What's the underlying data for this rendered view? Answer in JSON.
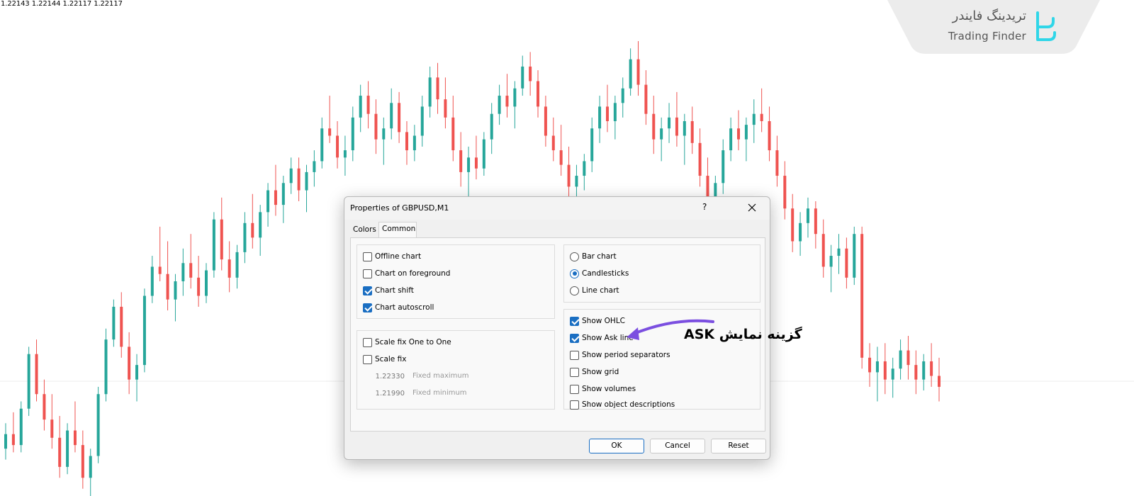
{
  "ohlc_readout": "1.22143 1.22144 1.22117 1.22117",
  "logo": {
    "persian_name": "تریدینگ فایندر",
    "english_name": "Trading Finder",
    "color": "#30d6e8"
  },
  "chart_data": {
    "type": "candlestick",
    "symbol": "GBPUSD",
    "timeframe": "M1",
    "bull_color": "#26a69a",
    "bear_color": "#ef5350",
    "grid": false,
    "candles": [
      {
        "o": 1.2171,
        "h": 1.2178,
        "l": 1.2168,
        "c": 1.2175
      },
      {
        "o": 1.2175,
        "h": 1.2181,
        "l": 1.217,
        "c": 1.2172
      },
      {
        "o": 1.2172,
        "h": 1.2184,
        "l": 1.217,
        "c": 1.2182
      },
      {
        "o": 1.2182,
        "h": 1.2199,
        "l": 1.218,
        "c": 1.2197
      },
      {
        "o": 1.2197,
        "h": 1.2201,
        "l": 1.2184,
        "c": 1.2186
      },
      {
        "o": 1.2186,
        "h": 1.219,
        "l": 1.2176,
        "c": 1.2179
      },
      {
        "o": 1.2179,
        "h": 1.2186,
        "l": 1.2171,
        "c": 1.2174
      },
      {
        "o": 1.2174,
        "h": 1.218,
        "l": 1.2163,
        "c": 1.2166
      },
      {
        "o": 1.2166,
        "h": 1.2178,
        "l": 1.2164,
        "c": 1.2176
      },
      {
        "o": 1.2176,
        "h": 1.2184,
        "l": 1.217,
        "c": 1.2172
      },
      {
        "o": 1.2172,
        "h": 1.2176,
        "l": 1.216,
        "c": 1.2163
      },
      {
        "o": 1.2163,
        "h": 1.2171,
        "l": 1.2158,
        "c": 1.2169
      },
      {
        "o": 1.2169,
        "h": 1.2188,
        "l": 1.2167,
        "c": 1.2186
      },
      {
        "o": 1.2186,
        "h": 1.2204,
        "l": 1.2184,
        "c": 1.2201
      },
      {
        "o": 1.2201,
        "h": 1.2212,
        "l": 1.2199,
        "c": 1.221
      },
      {
        "o": 1.221,
        "h": 1.2214,
        "l": 1.2196,
        "c": 1.2199
      },
      {
        "o": 1.2199,
        "h": 1.2203,
        "l": 1.2186,
        "c": 1.219
      },
      {
        "o": 1.219,
        "h": 1.2197,
        "l": 1.2184,
        "c": 1.2194
      },
      {
        "o": 1.2194,
        "h": 1.2215,
        "l": 1.2192,
        "c": 1.2213
      },
      {
        "o": 1.2213,
        "h": 1.2224,
        "l": 1.2211,
        "c": 1.2221
      },
      {
        "o": 1.2221,
        "h": 1.2232,
        "l": 1.2217,
        "c": 1.2219
      },
      {
        "o": 1.2219,
        "h": 1.2228,
        "l": 1.2209,
        "c": 1.2212
      },
      {
        "o": 1.2212,
        "h": 1.2219,
        "l": 1.2206,
        "c": 1.2217
      },
      {
        "o": 1.2217,
        "h": 1.2226,
        "l": 1.2213,
        "c": 1.2222
      },
      {
        "o": 1.2222,
        "h": 1.223,
        "l": 1.2215,
        "c": 1.2218
      },
      {
        "o": 1.2218,
        "h": 1.2224,
        "l": 1.221,
        "c": 1.2213
      },
      {
        "o": 1.2213,
        "h": 1.2222,
        "l": 1.2211,
        "c": 1.222
      },
      {
        "o": 1.222,
        "h": 1.2236,
        "l": 1.2218,
        "c": 1.2234
      },
      {
        "o": 1.2234,
        "h": 1.224,
        "l": 1.222,
        "c": 1.2223
      },
      {
        "o": 1.2223,
        "h": 1.2228,
        "l": 1.2214,
        "c": 1.2218
      },
      {
        "o": 1.2218,
        "h": 1.2227,
        "l": 1.2215,
        "c": 1.2225
      },
      {
        "o": 1.2225,
        "h": 1.2236,
        "l": 1.2222,
        "c": 1.2233
      },
      {
        "o": 1.2233,
        "h": 1.2241,
        "l": 1.2226,
        "c": 1.2229
      },
      {
        "o": 1.2229,
        "h": 1.2238,
        "l": 1.2224,
        "c": 1.2236
      },
      {
        "o": 1.2236,
        "h": 1.2244,
        "l": 1.2232,
        "c": 1.2242
      },
      {
        "o": 1.2242,
        "h": 1.2249,
        "l": 1.2235,
        "c": 1.2238
      },
      {
        "o": 1.2238,
        "h": 1.2246,
        "l": 1.2233,
        "c": 1.2244
      },
      {
        "o": 1.2244,
        "h": 1.2251,
        "l": 1.2241,
        "c": 1.2248
      },
      {
        "o": 1.2248,
        "h": 1.2251,
        "l": 1.2239,
        "c": 1.2242
      },
      {
        "o": 1.2242,
        "h": 1.2249,
        "l": 1.2236,
        "c": 1.2247
      },
      {
        "o": 1.2247,
        "h": 1.2253,
        "l": 1.2243,
        "c": 1.225
      },
      {
        "o": 1.225,
        "h": 1.2262,
        "l": 1.2248,
        "c": 1.2259
      },
      {
        "o": 1.2259,
        "h": 1.2268,
        "l": 1.2255,
        "c": 1.2257
      },
      {
        "o": 1.2257,
        "h": 1.2261,
        "l": 1.2248,
        "c": 1.2251
      },
      {
        "o": 1.2251,
        "h": 1.2257,
        "l": 1.2246,
        "c": 1.2253
      },
      {
        "o": 1.2253,
        "h": 1.2265,
        "l": 1.225,
        "c": 1.2262
      },
      {
        "o": 1.2262,
        "h": 1.2271,
        "l": 1.2258,
        "c": 1.2268
      },
      {
        "o": 1.2268,
        "h": 1.2272,
        "l": 1.2259,
        "c": 1.2263
      },
      {
        "o": 1.2263,
        "h": 1.2267,
        "l": 1.2252,
        "c": 1.2256
      },
      {
        "o": 1.2256,
        "h": 1.2262,
        "l": 1.2249,
        "c": 1.2259
      },
      {
        "o": 1.2259,
        "h": 1.227,
        "l": 1.2256,
        "c": 1.2266
      },
      {
        "o": 1.2266,
        "h": 1.2269,
        "l": 1.2255,
        "c": 1.2258
      },
      {
        "o": 1.2258,
        "h": 1.2261,
        "l": 1.2249,
        "c": 1.2253
      },
      {
        "o": 1.2253,
        "h": 1.226,
        "l": 1.225,
        "c": 1.2257
      },
      {
        "o": 1.2257,
        "h": 1.2268,
        "l": 1.2254,
        "c": 1.2265
      },
      {
        "o": 1.2265,
        "h": 1.2276,
        "l": 1.2262,
        "c": 1.2273
      },
      {
        "o": 1.2273,
        "h": 1.2277,
        "l": 1.2263,
        "c": 1.2267
      },
      {
        "o": 1.2267,
        "h": 1.2273,
        "l": 1.2259,
        "c": 1.2262
      },
      {
        "o": 1.2262,
        "h": 1.2268,
        "l": 1.225,
        "c": 1.2253
      },
      {
        "o": 1.2253,
        "h": 1.2258,
        "l": 1.2243,
        "c": 1.2247
      },
      {
        "o": 1.2247,
        "h": 1.2254,
        "l": 1.224,
        "c": 1.2251
      },
      {
        "o": 1.2251,
        "h": 1.2257,
        "l": 1.2245,
        "c": 1.2248
      },
      {
        "o": 1.2248,
        "h": 1.2258,
        "l": 1.2246,
        "c": 1.2256
      },
      {
        "o": 1.2256,
        "h": 1.2266,
        "l": 1.2252,
        "c": 1.2263
      },
      {
        "o": 1.2263,
        "h": 1.2271,
        "l": 1.226,
        "c": 1.2268
      },
      {
        "o": 1.2268,
        "h": 1.2274,
        "l": 1.2262,
        "c": 1.2265
      },
      {
        "o": 1.2265,
        "h": 1.2272,
        "l": 1.2259,
        "c": 1.227
      },
      {
        "o": 1.227,
        "h": 1.2279,
        "l": 1.2268,
        "c": 1.2276
      },
      {
        "o": 1.2276,
        "h": 1.228,
        "l": 1.2268,
        "c": 1.2272
      },
      {
        "o": 1.2272,
        "h": 1.2275,
        "l": 1.2262,
        "c": 1.2265
      },
      {
        "o": 1.2265,
        "h": 1.2268,
        "l": 1.2254,
        "c": 1.2257
      },
      {
        "o": 1.2257,
        "h": 1.2262,
        "l": 1.225,
        "c": 1.2253
      },
      {
        "o": 1.2253,
        "h": 1.226,
        "l": 1.2246,
        "c": 1.2249
      },
      {
        "o": 1.2249,
        "h": 1.2254,
        "l": 1.224,
        "c": 1.2243
      },
      {
        "o": 1.2243,
        "h": 1.2249,
        "l": 1.2238,
        "c": 1.2246
      },
      {
        "o": 1.2246,
        "h": 1.2252,
        "l": 1.2242,
        "c": 1.225
      },
      {
        "o": 1.225,
        "h": 1.2262,
        "l": 1.2247,
        "c": 1.2259
      },
      {
        "o": 1.2259,
        "h": 1.2268,
        "l": 1.2255,
        "c": 1.2265
      },
      {
        "o": 1.2265,
        "h": 1.2271,
        "l": 1.2258,
        "c": 1.2261
      },
      {
        "o": 1.2261,
        "h": 1.2268,
        "l": 1.2256,
        "c": 1.2266
      },
      {
        "o": 1.2266,
        "h": 1.2273,
        "l": 1.2262,
        "c": 1.227
      },
      {
        "o": 1.227,
        "h": 1.2281,
        "l": 1.2268,
        "c": 1.2278
      },
      {
        "o": 1.2278,
        "h": 1.2283,
        "l": 1.2268,
        "c": 1.2271
      },
      {
        "o": 1.2271,
        "h": 1.2275,
        "l": 1.226,
        "c": 1.2263
      },
      {
        "o": 1.2263,
        "h": 1.2268,
        "l": 1.2252,
        "c": 1.2256
      },
      {
        "o": 1.2256,
        "h": 1.2262,
        "l": 1.225,
        "c": 1.2259
      },
      {
        "o": 1.2259,
        "h": 1.2266,
        "l": 1.2255,
        "c": 1.2262
      },
      {
        "o": 1.2262,
        "h": 1.2269,
        "l": 1.2254,
        "c": 1.2257
      },
      {
        "o": 1.2257,
        "h": 1.2263,
        "l": 1.2249,
        "c": 1.2261
      },
      {
        "o": 1.2261,
        "h": 1.2265,
        "l": 1.2252,
        "c": 1.2255
      },
      {
        "o": 1.2255,
        "h": 1.2259,
        "l": 1.2243,
        "c": 1.2246
      },
      {
        "o": 1.2246,
        "h": 1.2251,
        "l": 1.2236,
        "c": 1.224
      },
      {
        "o": 1.224,
        "h": 1.2246,
        "l": 1.2234,
        "c": 1.2244
      },
      {
        "o": 1.2244,
        "h": 1.2256,
        "l": 1.2241,
        "c": 1.2253
      },
      {
        "o": 1.2253,
        "h": 1.2262,
        "l": 1.225,
        "c": 1.2259
      },
      {
        "o": 1.2259,
        "h": 1.2264,
        "l": 1.2253,
        "c": 1.2256
      },
      {
        "o": 1.2256,
        "h": 1.2262,
        "l": 1.225,
        "c": 1.226
      },
      {
        "o": 1.226,
        "h": 1.2267,
        "l": 1.2255,
        "c": 1.2263
      },
      {
        "o": 1.2263,
        "h": 1.227,
        "l": 1.2258,
        "c": 1.2261
      },
      {
        "o": 1.2261,
        "h": 1.2265,
        "l": 1.225,
        "c": 1.2253
      },
      {
        "o": 1.2253,
        "h": 1.2257,
        "l": 1.2243,
        "c": 1.2246
      },
      {
        "o": 1.2246,
        "h": 1.225,
        "l": 1.2234,
        "c": 1.2237
      },
      {
        "o": 1.2237,
        "h": 1.2241,
        "l": 1.2225,
        "c": 1.2228
      },
      {
        "o": 1.2228,
        "h": 1.2236,
        "l": 1.2224,
        "c": 1.2233
      },
      {
        "o": 1.2233,
        "h": 1.224,
        "l": 1.2229,
        "c": 1.2237
      },
      {
        "o": 1.2237,
        "h": 1.2239,
        "l": 1.2226,
        "c": 1.223
      },
      {
        "o": 1.223,
        "h": 1.2234,
        "l": 1.2218,
        "c": 1.2221
      },
      {
        "o": 1.2221,
        "h": 1.2227,
        "l": 1.2214,
        "c": 1.2224
      },
      {
        "o": 1.2224,
        "h": 1.223,
        "l": 1.2219,
        "c": 1.2226
      },
      {
        "o": 1.2226,
        "h": 1.2229,
        "l": 1.2215,
        "c": 1.2218
      },
      {
        "o": 1.2218,
        "h": 1.2232,
        "l": 1.2216,
        "c": 1.223
      },
      {
        "o": 1.223,
        "h": 1.2232,
        "l": 1.2193,
        "c": 1.2196
      },
      {
        "o": 1.2196,
        "h": 1.22,
        "l": 1.2188,
        "c": 1.2192
      },
      {
        "o": 1.2192,
        "h": 1.2199,
        "l": 1.2184,
        "c": 1.2195
      },
      {
        "o": 1.2195,
        "h": 1.22,
        "l": 1.2186,
        "c": 1.219
      },
      {
        "o": 1.219,
        "h": 1.2196,
        "l": 1.2185,
        "c": 1.2193
      },
      {
        "o": 1.2193,
        "h": 1.2201,
        "l": 1.219,
        "c": 1.2198
      },
      {
        "o": 1.2198,
        "h": 1.2202,
        "l": 1.219,
        "c": 1.2194
      },
      {
        "o": 1.2194,
        "h": 1.2198,
        "l": 1.2186,
        "c": 1.219
      },
      {
        "o": 1.219,
        "h": 1.2197,
        "l": 1.2187,
        "c": 1.2195
      },
      {
        "o": 1.2195,
        "h": 1.22,
        "l": 1.2188,
        "c": 1.2191
      },
      {
        "o": 1.2191,
        "h": 1.2196,
        "l": 1.2184,
        "c": 1.2188
      }
    ]
  },
  "dialog": {
    "title": "Properties of GBPUSD,M1",
    "help_label": "?",
    "tabs": [
      "Colors",
      "Common"
    ],
    "active_tab": "Common",
    "options_left": [
      {
        "label": "Offline chart",
        "checked": false
      },
      {
        "label": "Chart on foreground",
        "checked": false
      },
      {
        "label": "Chart shift",
        "checked": true
      },
      {
        "label": "Chart autoscroll",
        "checked": true
      }
    ],
    "scale_options": [
      {
        "label": "Scale fix One to One",
        "checked": false
      },
      {
        "label": "Scale fix",
        "checked": false
      }
    ],
    "fixed_max": {
      "value": "1.22330",
      "label": "Fixed maximum"
    },
    "fixed_min": {
      "value": "1.21990",
      "label": "Fixed minimum"
    },
    "chart_types": [
      {
        "label": "Bar chart",
        "selected": false
      },
      {
        "label": "Candlesticks",
        "selected": true
      },
      {
        "label": "Line chart",
        "selected": false
      }
    ],
    "show_options": [
      {
        "label": "Show OHLC",
        "checked": true
      },
      {
        "label": "Show Ask line",
        "checked": true
      },
      {
        "label": "Show period separators",
        "checked": false
      },
      {
        "label": "Show grid",
        "checked": false
      },
      {
        "label": "Show volumes",
        "checked": false
      },
      {
        "label": "Show object descriptions",
        "checked": false
      }
    ],
    "buttons": {
      "ok": "OK",
      "cancel": "Cancel",
      "reset": "Reset"
    }
  },
  "annotation": {
    "text": "گزینه نمایش ASK",
    "arrow_color": "#7b4fe0"
  }
}
